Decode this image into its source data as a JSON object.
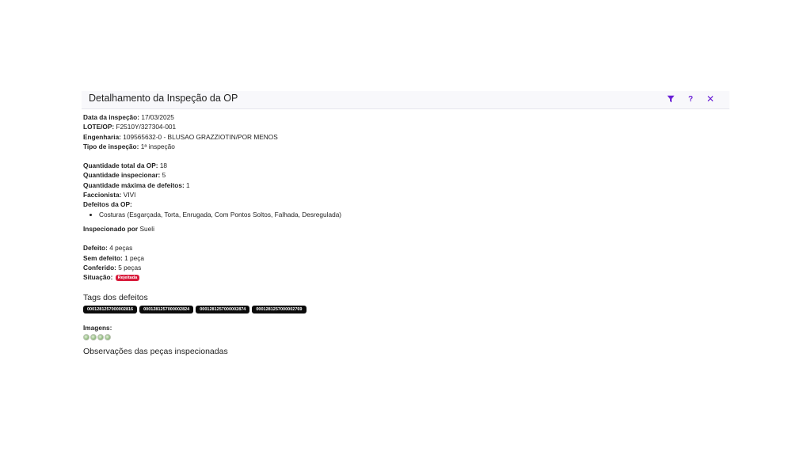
{
  "header": {
    "title": "Detalhamento da Inspeção da OP",
    "icons": [
      "filter-icon",
      "help-icon",
      "close-icon"
    ],
    "accent_color": "#6a1fd6"
  },
  "info": {
    "data_label": "Data da inspeção:",
    "data_value": "17/03/2025",
    "lote_label": "LOTE/OP:",
    "lote_value": "F2510Y/327304-001",
    "engenharia_label": "Engenharia:",
    "engenharia_value": "109565632-0 - BLUSAO GRAZZIOTIN/POR MENOS",
    "tipo_label": "Tipo de inspeção:",
    "tipo_value": "1ª inspeção"
  },
  "quantities": {
    "total_label": "Quantidade total da OP:",
    "total_value": "18",
    "inspecionar_label": "Quantidade inspecionar:",
    "inspecionar_value": "5",
    "max_defeitos_label": "Quantidade máxima de defeitos:",
    "max_defeitos_value": "1",
    "faccionista_label": "Faccionista:",
    "faccionista_value": "VIVI",
    "defeitos_label": "Defeitos da OP:",
    "defeitos_items": [
      "Costuras (Esgarçada, Torta, Enrugada, Com Pontos Soltos, Falhada, Desregulada)"
    ]
  },
  "inspector": {
    "label": "Inspecionado por",
    "value": "Sueli"
  },
  "results": {
    "defeito_label": "Defeito:",
    "defeito_value": "4 peças",
    "sem_defeito_label": "Sem defeito:",
    "sem_defeito_value": "1 peça",
    "conferido_label": "Conferido:",
    "conferido_value": "5 peças",
    "situacao_label": "Situação:",
    "situacao_badge": "Rejeitada",
    "badge_color": "#d81b3b"
  },
  "tags_section": {
    "title": "Tags dos defeitos",
    "tags": [
      "0001281257000002816",
      "0001281257000002824",
      "0001281257000002874",
      "0001281257000002769"
    ]
  },
  "images_section": {
    "label": "Imagens:",
    "count": 4
  },
  "observations": {
    "title": "Observações das peças inspecionadas"
  }
}
